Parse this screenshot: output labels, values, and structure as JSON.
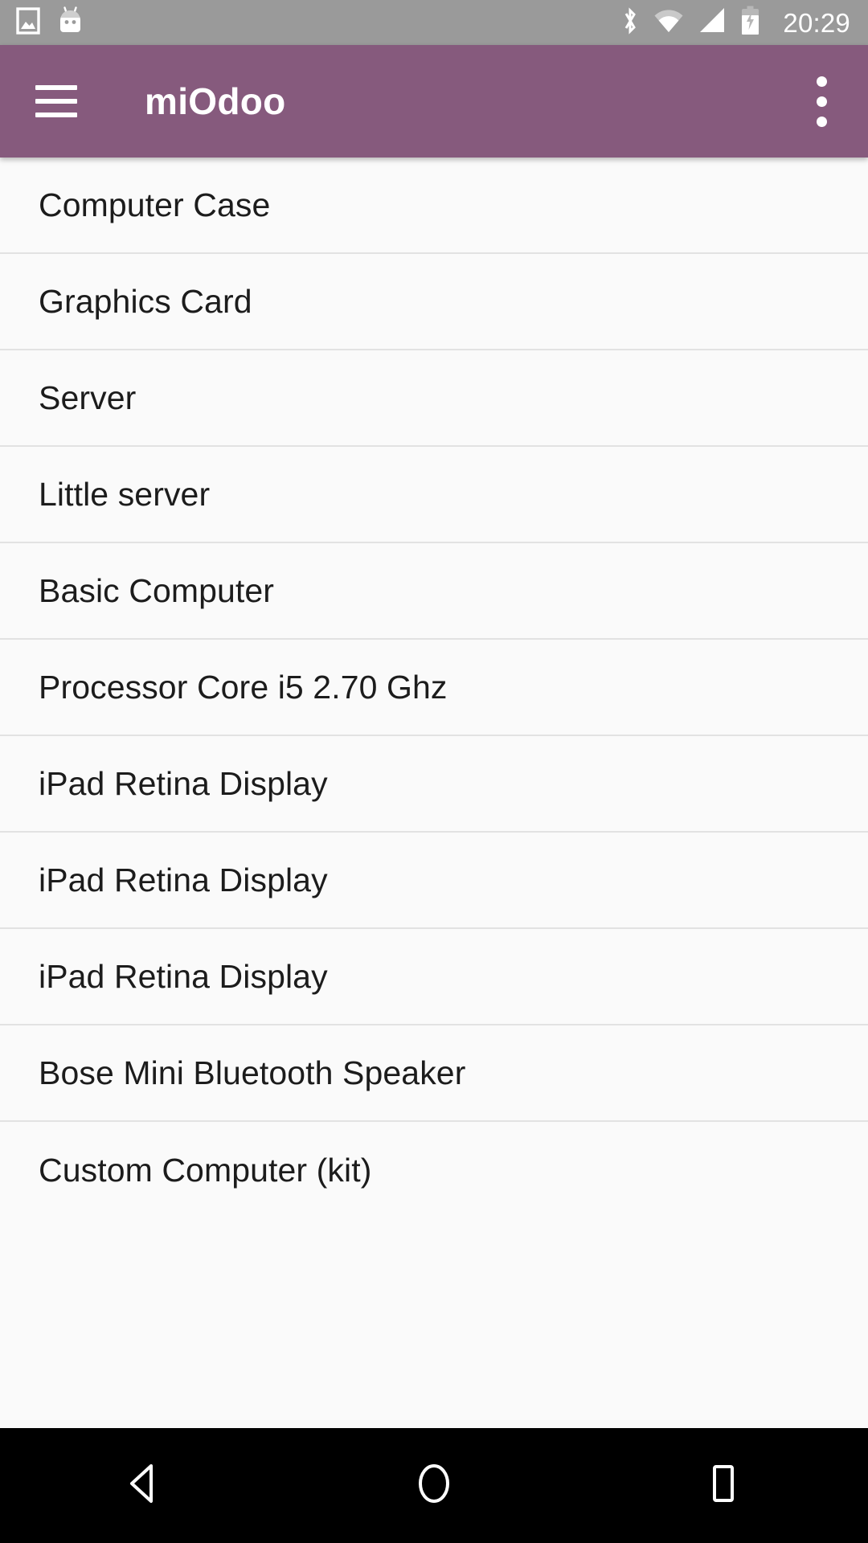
{
  "status_bar": {
    "left_icons": [
      {
        "name": "screenshot-icon",
        "label": "screenshot"
      },
      {
        "name": "android-mascot-icon",
        "label": "android-marshmallow"
      }
    ],
    "right_icons": [
      {
        "name": "bluetooth-icon",
        "label": "bluetooth"
      },
      {
        "name": "wifi-icon",
        "label": "wifi"
      },
      {
        "name": "cellular-signal-icon",
        "label": "cellular-signal"
      },
      {
        "name": "battery-charging-icon",
        "label": "battery-charging"
      }
    ],
    "clock": "20:29",
    "background_color": "#9a9a9a",
    "foreground_color": "#ffffff"
  },
  "app_bar": {
    "title": "miOdoo",
    "menu_icon": "hamburger-icon",
    "overflow_icon": "overflow-menu-icon",
    "background_color": "#865a7d",
    "title_color": "#ffffff"
  },
  "product_list": {
    "background_color": "#fafafa",
    "divider_color": "#e2e2e2",
    "text_color": "#1c1c1c",
    "items": [
      {
        "label": "Computer Case"
      },
      {
        "label": "Graphics Card"
      },
      {
        "label": "Server"
      },
      {
        "label": "Little server"
      },
      {
        "label": "Basic Computer"
      },
      {
        "label": "Processor Core i5 2.70 Ghz"
      },
      {
        "label": "iPad Retina Display"
      },
      {
        "label": "iPad Retina Display"
      },
      {
        "label": "iPad Retina Display"
      },
      {
        "label": "Bose Mini Bluetooth Speaker"
      },
      {
        "label": "Custom Computer (kit)"
      }
    ]
  },
  "navigation_bar": {
    "background_color": "#000000",
    "buttons": [
      {
        "name": "back-button",
        "icon": "back-triangle-icon"
      },
      {
        "name": "home-button",
        "icon": "home-circle-icon"
      },
      {
        "name": "recents-button",
        "icon": "recents-square-icon"
      }
    ]
  }
}
